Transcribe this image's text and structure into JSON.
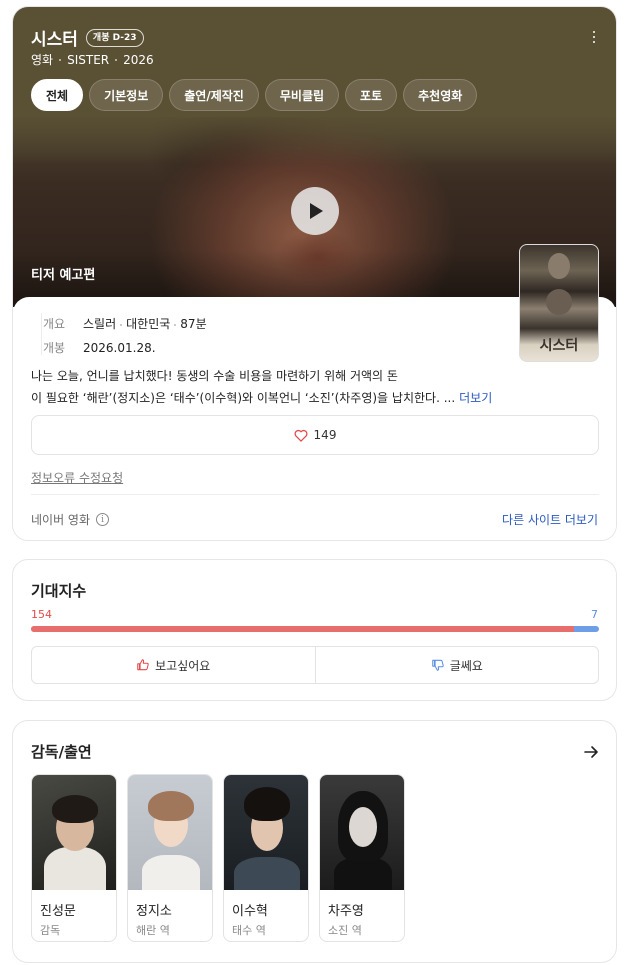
{
  "movie": {
    "title": "시스터",
    "dday_badge": "개봉 D-23",
    "category": "영화",
    "english_title": "SISTER",
    "year": "2026"
  },
  "tabs": [
    {
      "label": "전체",
      "active": true
    },
    {
      "label": "기본정보",
      "active": false
    },
    {
      "label": "출연/제작진",
      "active": false
    },
    {
      "label": "무비클립",
      "active": false
    },
    {
      "label": "포토",
      "active": false
    },
    {
      "label": "추천영화",
      "active": false
    }
  ],
  "video": {
    "label": "티저 예고편",
    "play_icon": "play-icon"
  },
  "poster": {
    "title": "시스터"
  },
  "info": {
    "overview_label": "개요",
    "genre": "스릴러",
    "country": "대한민국",
    "runtime": "87분",
    "release_label": "개봉",
    "release_date": "2026.01.28."
  },
  "synopsis": {
    "line1": "나는 오늘, 언니를 납치했다! 동생의 수술 비용을 마련하기 위해 거액의 돈",
    "line2": "이 필요한 ‘해란’(정지소)은 ‘태수’(이수혁)와 이복언니 ‘소진’(차주영)을 납치한다. ...",
    "more_label": "더보기"
  },
  "likes": {
    "count": "149",
    "icon": "heart-icon"
  },
  "report_link": "정보오류 수정요청",
  "source": {
    "label": "네이버 영화",
    "other_sites": "다른 사이트 더보기"
  },
  "expectation": {
    "title": "기대지수",
    "like_count": "154",
    "dislike_count": "7",
    "like_fraction": 0.9565,
    "want_label": "보고싶어요",
    "meh_label": "글쎄요",
    "like_color": "#e86e6e",
    "dislike_color": "#6f9ee8"
  },
  "cast": {
    "title": "감독/출연",
    "members": [
      {
        "name": "진성문",
        "role": "감독"
      },
      {
        "name": "정지소",
        "role": "해란 역"
      },
      {
        "name": "이수혁",
        "role": "태수 역"
      },
      {
        "name": "차주영",
        "role": "소진 역"
      }
    ]
  },
  "colors": {
    "header_bg": "#5a5034",
    "link_blue": "#2b59c3"
  }
}
